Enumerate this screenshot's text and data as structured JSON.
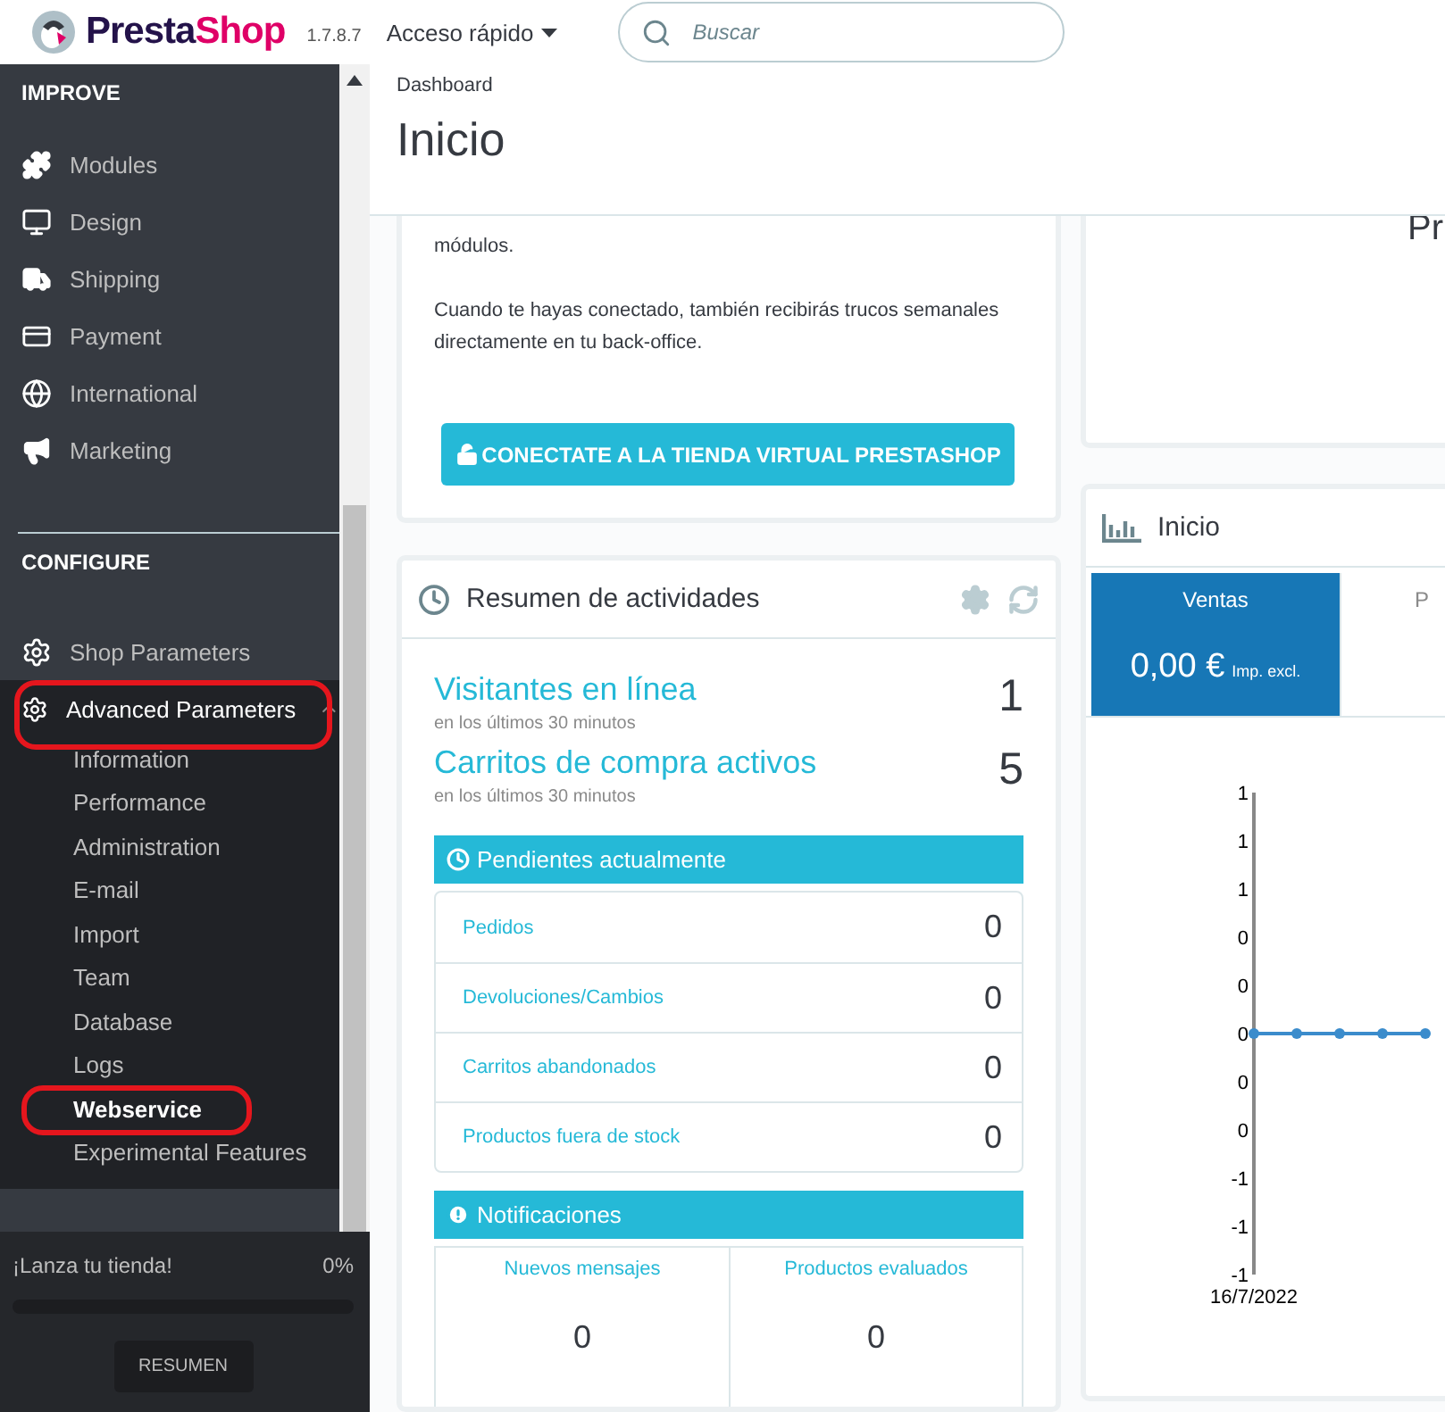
{
  "header": {
    "logo": [
      "Presta",
      "Shop"
    ],
    "version": "1.7.8.7",
    "quick_access": "Acceso rápido",
    "search": {
      "placeholder": "Buscar"
    }
  },
  "sidebar": {
    "sections": [
      {
        "title": "IMPROVE",
        "items": [
          {
            "label": "Modules",
            "selected": false,
            "highlighted": false
          },
          {
            "label": "Design",
            "selected": false,
            "highlighted": false
          },
          {
            "label": "Shipping",
            "selected": false,
            "highlighted": false
          },
          {
            "label": "Payment",
            "selected": false,
            "highlighted": false
          },
          {
            "label": "International",
            "selected": false,
            "highlighted": false
          },
          {
            "label": "Marketing",
            "selected": false,
            "highlighted": false
          }
        ]
      },
      {
        "title": "CONFIGURE",
        "items": [
          {
            "label": "Shop Parameters",
            "selected": false,
            "highlighted": false
          },
          {
            "label": "Advanced Parameters",
            "selected": true,
            "highlighted": true,
            "expanded": true,
            "children": [
              {
                "label": "Information",
                "selected": false,
                "highlighted": false
              },
              {
                "label": "Performance",
                "selected": false,
                "highlighted": false
              },
              {
                "label": "Administration",
                "selected": false,
                "highlighted": false
              },
              {
                "label": "E-mail",
                "selected": false,
                "highlighted": false
              },
              {
                "label": "Import",
                "selected": false,
                "highlighted": false
              },
              {
                "label": "Team",
                "selected": false,
                "highlighted": false
              },
              {
                "label": "Database",
                "selected": false,
                "highlighted": false
              },
              {
                "label": "Logs",
                "selected": false,
                "highlighted": false
              },
              {
                "label": "Webservice",
                "selected": true,
                "highlighted": true
              },
              {
                "label": "Experimental Features",
                "selected": false,
                "highlighted": false
              }
            ]
          }
        ]
      }
    ]
  },
  "launch": {
    "label": "¡Lanza tu tienda!",
    "percent": "0%",
    "level": 0,
    "button": "RESUMEN"
  },
  "breadcrumb": "Dashboard",
  "page_title": "Inicio",
  "connect_card": {
    "paragraphs": [
      "módulos.",
      "Cuando te hayas conectado, también recibirás trucos semanales directamente en tu back-office."
    ],
    "button": "CONECTATE A LA TIENDA VIRTUAL PRESTASHOP"
  },
  "activity": {
    "title": "Resumen de actividades",
    "stats": [
      {
        "label": "Visitantes en línea",
        "sublabel": "en los últimos 30 minutos",
        "value": "1"
      },
      {
        "label": "Carritos de compra activos",
        "sublabel": "en los últimos 30 minutos",
        "value": "5"
      }
    ],
    "pending": {
      "title": "Pendientes actualmente",
      "rows": [
        {
          "label": "Pedidos",
          "value": "0"
        },
        {
          "label": "Devoluciones/Cambios",
          "value": "0"
        },
        {
          "label": "Carritos abandonados",
          "value": "0"
        },
        {
          "label": "Productos fuera de stock",
          "value": "0"
        }
      ]
    },
    "notifications": {
      "title": "Notificaciones",
      "columns": [
        {
          "label": "Nuevos mensajes",
          "value": "0"
        },
        {
          "label": "Productos evaluados",
          "value": "0"
        }
      ]
    }
  },
  "promo_card": {
    "title": "Pr"
  },
  "dashboard": {
    "title": "Inicio",
    "tabs": [
      {
        "label": "Ventas",
        "value": "0,00 €",
        "note": "Imp. excl.",
        "selected": true
      },
      {
        "label": "P",
        "selected": false
      }
    ],
    "chart_data": {
      "type": "line",
      "xlabel": "16/7/2022",
      "series": [
        {
          "color": "#3b8ccc",
          "marker": "circle",
          "values": [
            0,
            0,
            0,
            0,
            0
          ]
        }
      ],
      "ylim": [
        -1,
        1
      ],
      "yticks": [
        {
          "value": 1,
          "label": "1"
        },
        {
          "value": 0.8,
          "label": "1"
        },
        {
          "value": 0.6,
          "label": "1"
        },
        {
          "value": 0.4,
          "label": "0"
        },
        {
          "value": 0.2,
          "label": "0"
        },
        {
          "value": 0,
          "label": "0"
        },
        {
          "value": -0.2,
          "label": "0"
        },
        {
          "value": -0.4,
          "label": "0"
        },
        {
          "value": -0.6,
          "label": "-1"
        },
        {
          "value": -0.8,
          "label": "-1"
        },
        {
          "value": -1,
          "label": "-1"
        }
      ]
    }
  }
}
